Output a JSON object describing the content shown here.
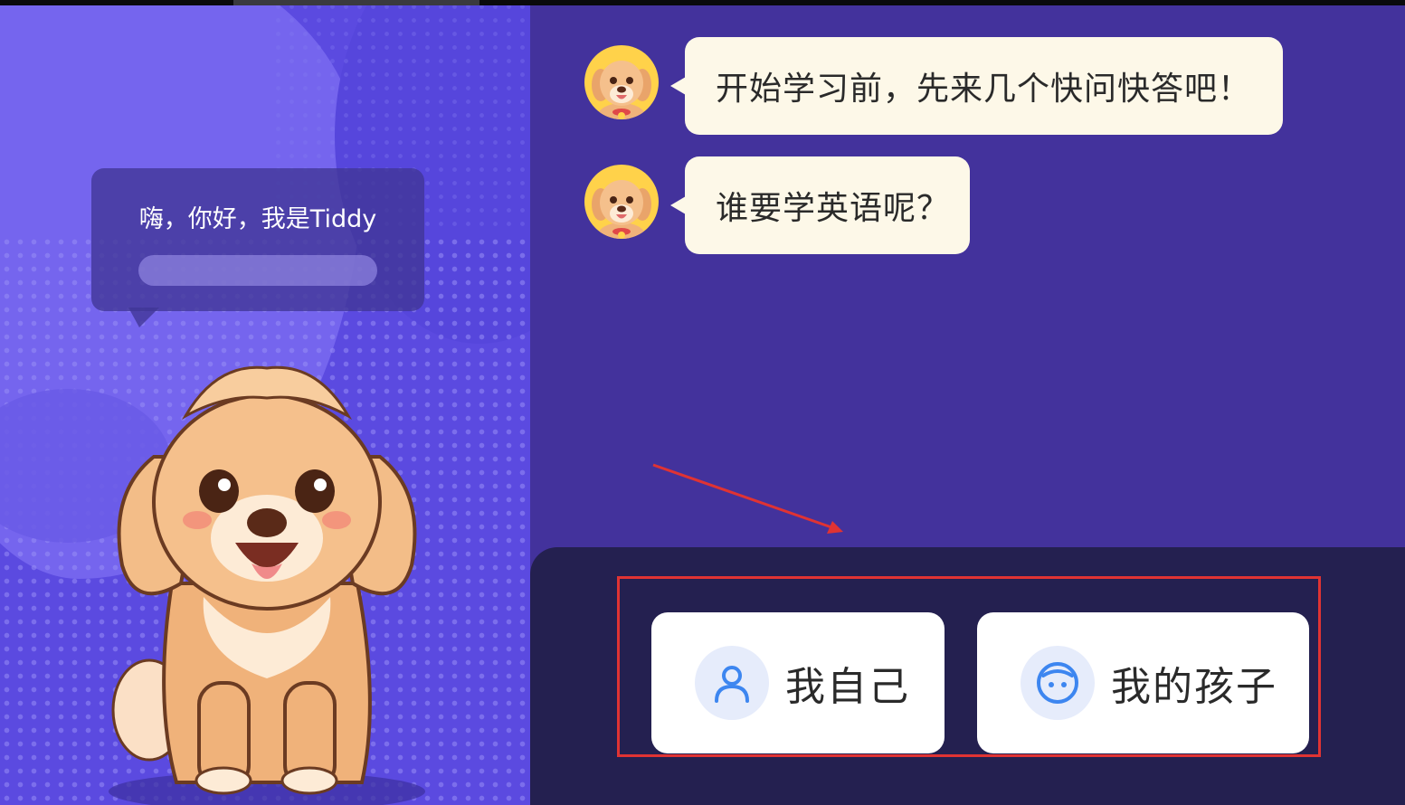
{
  "greeting": {
    "text": "嗨，你好，我是Tiddy"
  },
  "chat": {
    "messages": [
      {
        "text": "开始学习前，先来几个快问快答吧！"
      },
      {
        "text": "谁要学英语呢？"
      }
    ]
  },
  "options": [
    {
      "label": "我自己",
      "icon": "person-icon"
    },
    {
      "label": "我的孩子",
      "icon": "child-face-icon"
    }
  ],
  "colors": {
    "left_bg": "#5b4ae0",
    "right_bg": "#43329c",
    "bottom_bg": "#242050",
    "bubble_bg": "#fdf8e8",
    "icon_blue": "#3d86f0",
    "highlight_red": "#e03333"
  }
}
